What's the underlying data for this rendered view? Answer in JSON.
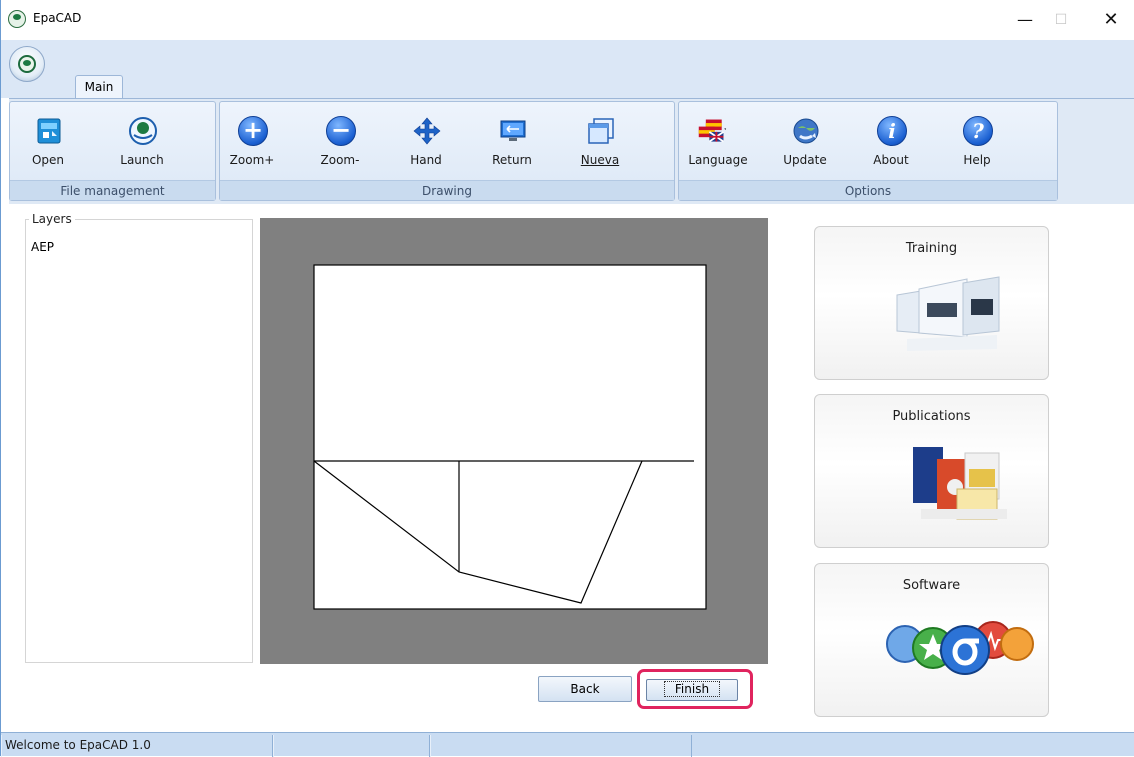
{
  "window": {
    "title": "EpaCAD"
  },
  "ribbon": {
    "tab_main": "Main",
    "groups": {
      "file_management": {
        "label": "File management",
        "buttons": {
          "open": "Open",
          "launch": "Launch"
        }
      },
      "drawing": {
        "label": "Drawing",
        "buttons": {
          "zoom_in": "Zoom+",
          "zoom_out": "Zoom-",
          "hand": "Hand",
          "return": "Return",
          "nueva": "Nueva"
        }
      },
      "options": {
        "label": "Options",
        "buttons": {
          "language": "Language",
          "update": "Update",
          "about": "About",
          "help": "Help"
        }
      }
    }
  },
  "layers": {
    "legend": "Layers",
    "items": [
      "AEP"
    ]
  },
  "buttons": {
    "back": "Back",
    "finish": "Finish"
  },
  "panels": {
    "training": "Training",
    "publications": "Publications",
    "software": "Software"
  },
  "statusbar": {
    "message": "Welcome to EpaCAD 1.0",
    "cell2": "",
    "cell3": ""
  },
  "colors": {
    "highlight": "#e0245e",
    "canvas_bg": "#808080",
    "ribbon_bg": "#dfe9f5"
  }
}
